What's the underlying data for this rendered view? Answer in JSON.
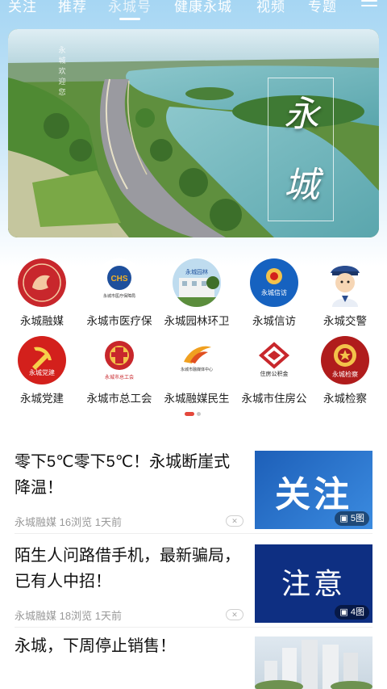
{
  "nav": {
    "tabs": [
      "关注",
      "推荐",
      "永城号",
      "健康永城",
      "视频",
      "专题"
    ],
    "active_index": 2
  },
  "banner": {
    "title_chars": [
      "永",
      "城"
    ],
    "subtitle": "永城欢迎您"
  },
  "shortcuts": [
    {
      "label": "永城融媒",
      "icon_text": "",
      "color": "#c8272c"
    },
    {
      "label": "永城市医疗保",
      "icon_text": "永城市医疗保障局",
      "color": "#1e4f9c"
    },
    {
      "label": "永城园林环卫",
      "icon_text": "永城园林",
      "color": "#4a8fc4"
    },
    {
      "label": "永城信访",
      "icon_text": "永城信访",
      "color": "#1662c0"
    },
    {
      "label": "永城交警",
      "icon_text": "",
      "color": "#2f6fc0"
    },
    {
      "label": "永城党建",
      "icon_text": "永城党建",
      "color": "#d3201c"
    },
    {
      "label": "永城市总工会",
      "icon_text": "永城市总工会",
      "color": "#c8272c"
    },
    {
      "label": "永城融媒民生",
      "icon_text": "永城市融媒体中心",
      "color": "#f0a020"
    },
    {
      "label": "永城市住房公",
      "icon_text": "住房公积金",
      "color": "#c8272c"
    },
    {
      "label": "永城检察",
      "icon_text": "永城检察",
      "color": "#b01c1c"
    }
  ],
  "articles": [
    {
      "title": "零下5℃零下5℃！永城断崖式降温！",
      "source": "永城融媒",
      "views": "16浏览",
      "time": "1天前",
      "thumb_text": "关注",
      "badge": "5图"
    },
    {
      "title": "陌生人问路借手机，最新骗局，已有人中招！",
      "source": "永城融媒",
      "views": "18浏览",
      "time": "1天前",
      "thumb_text": "注意",
      "badge": "4图"
    },
    {
      "title": "永城，下周停止销售！",
      "source": "",
      "views": "",
      "time": "",
      "thumb_text": "",
      "badge": ""
    }
  ]
}
